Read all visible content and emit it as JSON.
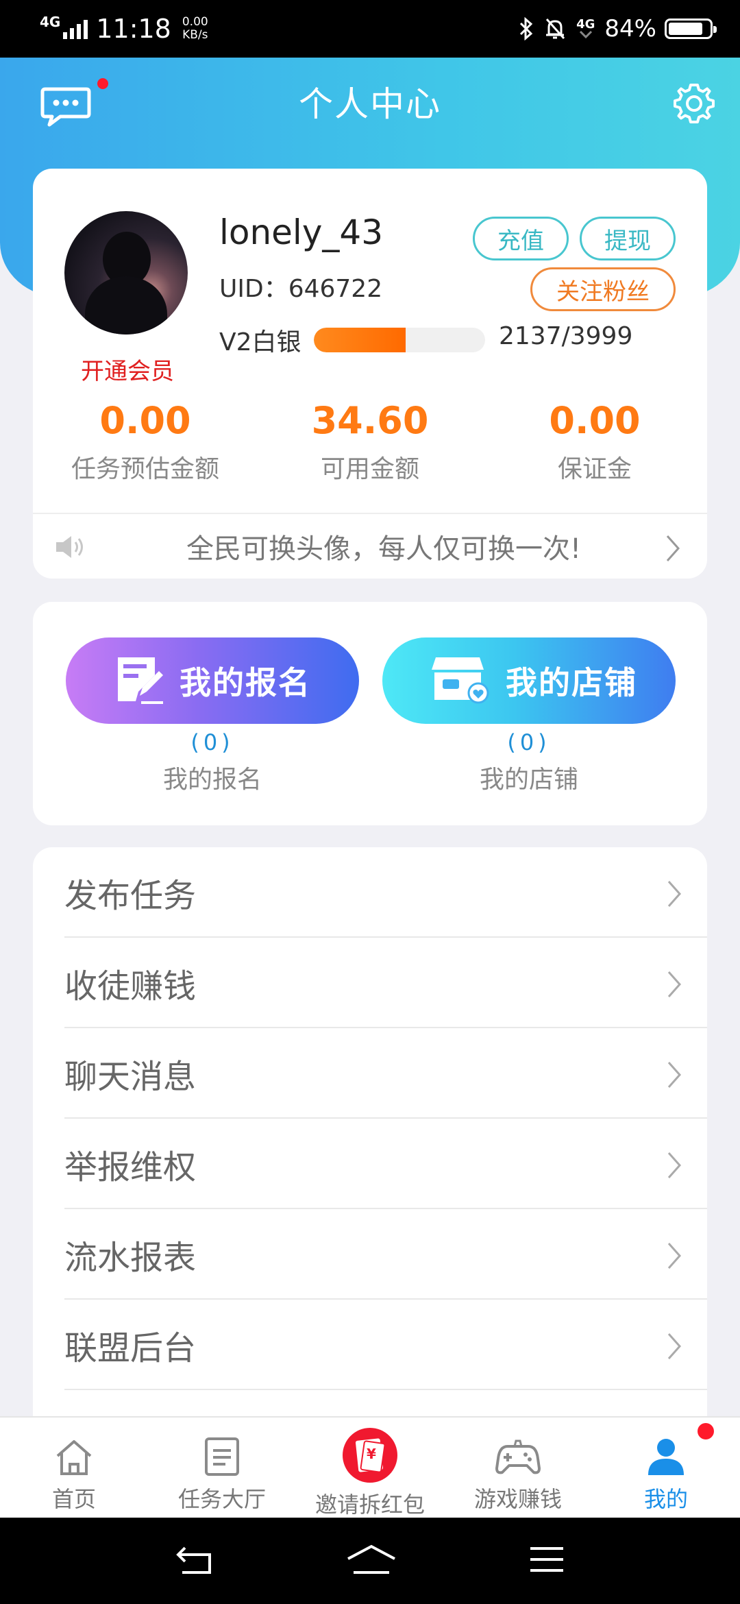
{
  "status_bar": {
    "network": "4G",
    "time": "11:18",
    "speed_value": "0.00",
    "speed_unit": "KB/s",
    "network2": "4G",
    "battery": "84%"
  },
  "header": {
    "title": "个人中心",
    "message_icon": "chat-bubble-icon",
    "settings_icon": "gear-icon"
  },
  "profile": {
    "username": "lonely_43",
    "uid": "UID：646722",
    "open_vip": "开通会员",
    "level_name": "V2白银",
    "level_progress": 0.534,
    "level_count": "2137/3999",
    "recharge": "充值",
    "withdraw": "提现",
    "follow_fans": "关注粉丝"
  },
  "stats": [
    {
      "value": "0.00",
      "label": "任务预估金额"
    },
    {
      "value": "34.60",
      "label": "可用金额"
    },
    {
      "value": "0.00",
      "label": "保证金"
    }
  ],
  "notice": {
    "text": "全民可换头像，每人仅可换一次!"
  },
  "actions": {
    "signup": {
      "label": "我的报名",
      "count": "(0)",
      "sub": "我的报名"
    },
    "shop": {
      "label": "我的店铺",
      "count": "(0)",
      "sub": "我的店铺"
    }
  },
  "menu": [
    {
      "label": "发布任务"
    },
    {
      "label": "收徒赚钱"
    },
    {
      "label": "聊天消息"
    },
    {
      "label": "举报维权"
    },
    {
      "label": "流水报表"
    },
    {
      "label": "联盟后台"
    }
  ],
  "tabs": [
    {
      "label": "首页",
      "icon": "home-icon"
    },
    {
      "label": "任务大厅",
      "icon": "document-icon"
    },
    {
      "label": "邀请拆红包",
      "icon": "red-envelope-icon"
    },
    {
      "label": "游戏赚钱",
      "icon": "gamepad-icon"
    },
    {
      "label": "我的",
      "icon": "user-icon"
    }
  ],
  "colors": {
    "header_start": "#3aa7ec",
    "header_end": "#4bd3e3",
    "stat_value": "#ff7a13",
    "active_tab": "#1a8fe8",
    "vip_red": "#e02020"
  }
}
